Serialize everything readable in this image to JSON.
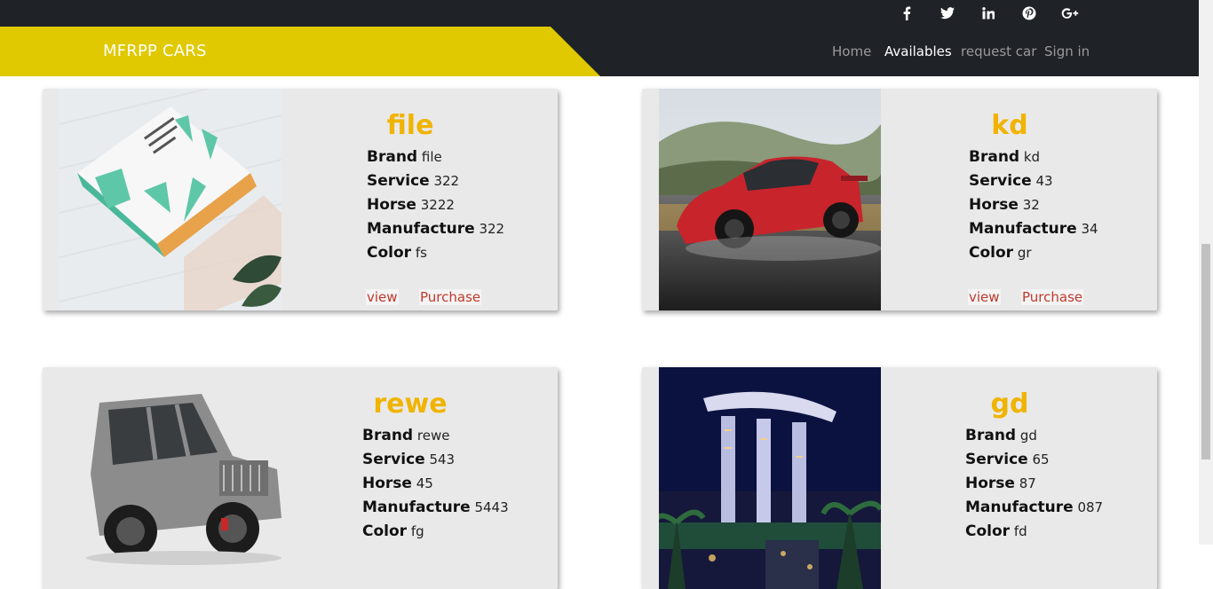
{
  "topbar": {
    "social": [
      {
        "icon": "facebook-icon",
        "glyph": "f"
      },
      {
        "icon": "twitter-icon",
        "glyph": "🐦"
      },
      {
        "icon": "linkedin-icon",
        "glyph": "in"
      },
      {
        "icon": "pinterest-icon",
        "glyph": "ⓟ"
      },
      {
        "icon": "google-plus-icon",
        "glyph": "g+"
      }
    ]
  },
  "navbar": {
    "brand": "MFRPP CARS",
    "links": [
      "Home",
      "Availables",
      "request car",
      "Sign in"
    ],
    "active": "Availables"
  },
  "labels": {
    "brand": "Brand",
    "service": "Service",
    "horse": "Horse",
    "manufacture": "Manufacture",
    "color": "Color",
    "view": "view",
    "purchase": "Purchase"
  },
  "cars": [
    {
      "name": "file",
      "brand": "file",
      "service": "322",
      "horse": "3222",
      "manufacture": "322",
      "color": "fs",
      "image": "book"
    },
    {
      "name": "kd",
      "brand": "kd",
      "service": "43",
      "horse": "32",
      "manufacture": "34",
      "color": "gr",
      "image": "red-car"
    },
    {
      "name": "rewe",
      "brand": "rewe",
      "service": "543",
      "horse": "45",
      "manufacture": "5443",
      "color": "fg",
      "image": "suv"
    },
    {
      "name": "gd",
      "brand": "gd",
      "service": "65",
      "horse": "87",
      "manufacture": "087",
      "color": "fd",
      "image": "marina-bay"
    }
  ],
  "colors": {
    "accent": "#e0c900",
    "title": "#f0b400",
    "link": "#c0392b",
    "nav_bg": "#1f2227"
  }
}
